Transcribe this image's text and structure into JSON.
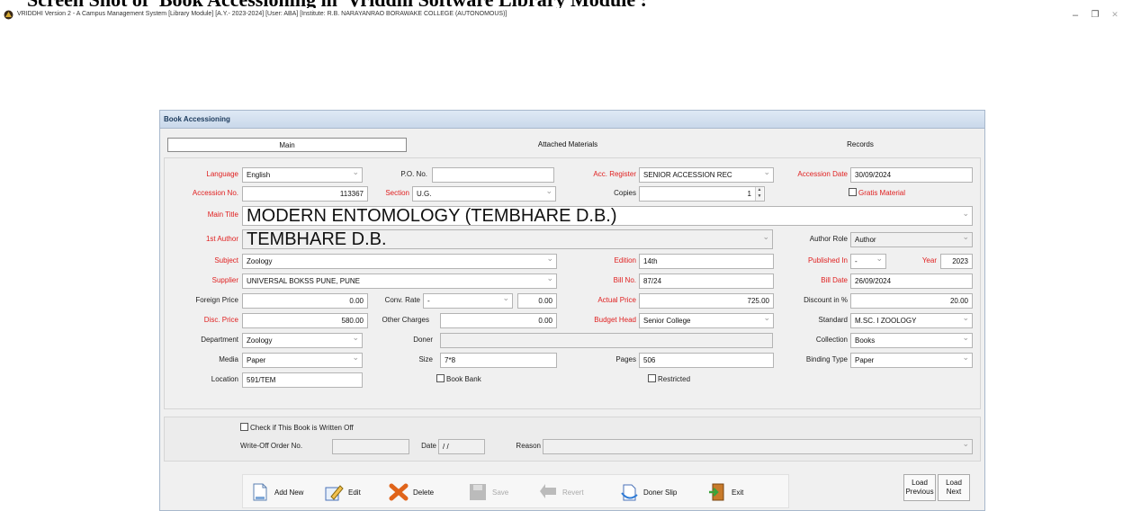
{
  "doc_heading": "Screen Shot of 'Book Accessioning in' Vriddhi Software Library Module :",
  "app": {
    "title": "VRIDDHI Version 2 - A Campus Management System [Library Module] [A.Y.- 2023-2024] [User: ABA] [Institute: R.B. NARAYANRAO BORAWAKE COLLEGE (AUTONOMOUS)]",
    "minimize": "–",
    "restore": "❐",
    "close": "✕"
  },
  "form": {
    "title": "Book Accessioning",
    "tabs": [
      "Main",
      "Attached Materials",
      "Records"
    ],
    "fields": {
      "language": {
        "label": "Language",
        "value": "English"
      },
      "po_no": {
        "label": "P.O. No.",
        "value": ""
      },
      "acc_register": {
        "label": "Acc. Register",
        "value": "SENIOR ACCESSION REC"
      },
      "accession_date": {
        "label": "Accession Date",
        "value": "30/09/2024"
      },
      "accession_no": {
        "label": "Accession No.",
        "value": "113367"
      },
      "section": {
        "label": "Section",
        "value": "U.G."
      },
      "copies": {
        "label": "Copies",
        "value": "1"
      },
      "gratis_material": {
        "label": "Gratis Material"
      },
      "main_title": {
        "label": "Main Title",
        "value": "MODERN ENTOMOLOGY (TEMBHARE D.B.)"
      },
      "first_author": {
        "label": "1st Author",
        "value": "TEMBHARE D.B."
      },
      "author_role": {
        "label": "Author Role",
        "value": "Author"
      },
      "subject": {
        "label": "Subject",
        "value": "Zoology"
      },
      "edition": {
        "label": "Edition",
        "value": "14th"
      },
      "published_in": {
        "label": "Published In",
        "value": "-"
      },
      "year": {
        "label": "Year",
        "value": "2023"
      },
      "supplier": {
        "label": "Supplier",
        "value": "UNIVERSAL BOKSS PUNE, PUNE"
      },
      "bill_no": {
        "label": "Bill No.",
        "value": "87/24"
      },
      "bill_date": {
        "label": "Bill Date",
        "value": "26/09/2024"
      },
      "foreign_price": {
        "label": "Foreign Price",
        "value": "0.00"
      },
      "conv_rate": {
        "label": "Conv. Rate",
        "value": "-",
        "amount": "0.00"
      },
      "actual_price": {
        "label": "Actual Price",
        "value": "725.00"
      },
      "discount": {
        "label": "Discount in %",
        "value": "20.00"
      },
      "disc_price": {
        "label": "Disc. Price",
        "value": "580.00"
      },
      "other_charges": {
        "label": "Other Charges",
        "value": "0.00"
      },
      "budget_head": {
        "label": "Budget Head",
        "value": "Senior College"
      },
      "standard": {
        "label": "Standard",
        "value": "M.SC. I ZOOLOGY"
      },
      "department": {
        "label": "Department",
        "value": "Zoology"
      },
      "doner": {
        "label": "Doner",
        "value": ""
      },
      "collection": {
        "label": "Collection",
        "value": "Books"
      },
      "media": {
        "label": "Media",
        "value": "Paper"
      },
      "size": {
        "label": "Size",
        "value": "7*8"
      },
      "pages": {
        "label": "Pages",
        "value": "506"
      },
      "binding_type": {
        "label": "Binding Type",
        "value": "Paper"
      },
      "location": {
        "label": "Location",
        "value": "591/TEM"
      },
      "book_bank": {
        "label": "Book Bank"
      },
      "restricted": {
        "label": "Restricted"
      }
    },
    "writeoff": {
      "check_label": "Check if This Book is Written Off",
      "order_label": "Write-Off Order No.",
      "order_value": "",
      "date_label": "Date",
      "date_value": "/ /",
      "reason_label": "Reason",
      "reason_value": ""
    },
    "buttons": {
      "add_new": "Add New",
      "edit": "Edit",
      "delete": "Delete",
      "save": "Save",
      "revert": "Revert",
      "doner_slip": "Doner Slip",
      "exit": "Exit",
      "load_previous": "Load Previous",
      "load_next": "Load Next"
    }
  },
  "colors": {
    "required_label": "#e02020",
    "titlebar": "#c9d8ea"
  }
}
